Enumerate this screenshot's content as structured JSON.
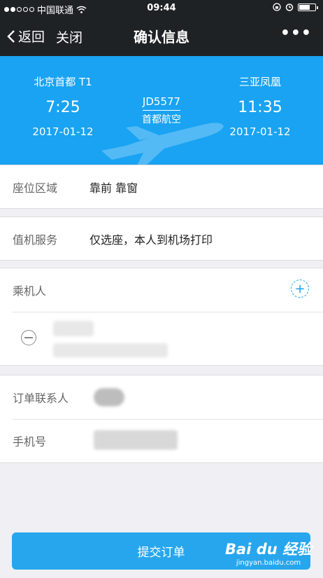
{
  "status_bar": {
    "carrier": "中国联通",
    "time": "09:44",
    "signal_dots_filled": 2,
    "signal_dots_total": 5,
    "battery_level": 0.7,
    "icons": [
      "wifi-icon",
      "orientation-lock-icon",
      "alarm-icon",
      "battery-icon"
    ]
  },
  "nav": {
    "back_label": "返回",
    "close_label": "关闭",
    "title": "确认信息",
    "more_label": "•••"
  },
  "flight": {
    "departure": {
      "airport": "北京首都 T1",
      "time": "7:25",
      "date": "2017-01-12"
    },
    "arrival": {
      "airport": "三亚凤凰",
      "time": "11:35",
      "date": "2017-01-12"
    },
    "flight_number": "JD5577",
    "airline": "首都航空",
    "background_color": "#19a3f2"
  },
  "seat": {
    "label": "座位区域",
    "value": "靠前 靠窗"
  },
  "checkin": {
    "label": "值机服务",
    "value": "仅选座，本人到机场打印"
  },
  "passengers": {
    "label": "乘机人",
    "add_icon": "plus-circle-icon",
    "remove_icon": "minus-circle-icon"
  },
  "contact": {
    "name_label": "订单联系人",
    "phone_label": "手机号"
  },
  "submit": {
    "label": "提交订单",
    "color": "#27a6ee"
  },
  "watermark": {
    "brand": "Bai du 经验",
    "url": "jingyan.baidu.com"
  }
}
